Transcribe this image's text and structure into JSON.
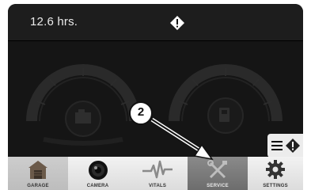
{
  "status": {
    "hours": "12.6 hrs."
  },
  "callout": {
    "number": "2"
  },
  "nav": {
    "tabs": [
      {
        "label": "GARAGE"
      },
      {
        "label": "CAMERA"
      },
      {
        "label": "VITALS"
      },
      {
        "label": "SERVICE"
      },
      {
        "label": "SETTINGS"
      }
    ],
    "selected": "SERVICE"
  },
  "colors": {
    "screen_bg": "#111111",
    "status_bar": "#1d1d1d",
    "nav_bar": "#d9d9d9",
    "selected_tab": "#7a7a7a"
  },
  "icons": [
    "alert-diamond-icon",
    "menu-icon",
    "garage-icon",
    "camera-icon",
    "vitals-icon",
    "service-icon",
    "settings-icon",
    "engine-icon",
    "fuel-icon"
  ]
}
